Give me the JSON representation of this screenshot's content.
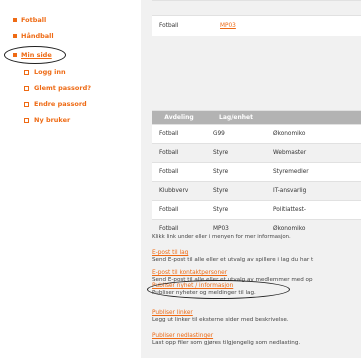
{
  "sidebar": {
    "items": [
      {
        "label": "Fotball"
      },
      {
        "label": "Håndball"
      },
      {
        "label": "Min side"
      }
    ],
    "sub_items": [
      {
        "label": "Logg inn"
      },
      {
        "label": "Glemt passord?"
      },
      {
        "label": "Endre passord"
      },
      {
        "label": "Ny bruker"
      }
    ]
  },
  "top_table": {
    "row1": {
      "avdeling": "",
      "lag": ""
    },
    "row2": {
      "avdeling": "Fotball",
      "lag": "MP03"
    }
  },
  "table": {
    "headers": [
      "Avdeling",
      "Lag/enhet",
      ""
    ],
    "rows": [
      [
        "Fotball",
        "G99",
        "Økonomiko"
      ],
      [
        "Fotball",
        "Styre",
        "Webmaster"
      ],
      [
        "Fotball",
        "Styre",
        "Styremedler"
      ],
      [
        "Klubbverv",
        "Styre",
        "IT-ansvarlig"
      ],
      [
        "Fotball",
        "Styre",
        "Politiattest-"
      ],
      [
        "Fotball",
        "MP03",
        "Økonomiko"
      ]
    ]
  },
  "hint": "Klikk link under eller i menyen for mer informasjon.",
  "links": [
    {
      "title": "E-post til lag",
      "desc": "Send E-post til alle eller et utvalg av spillere i lag du har t"
    },
    {
      "title": "E-post til kontaktpersoner",
      "desc": "Send E-post til alle eller et utvalg av medlemmer med op"
    },
    {
      "title": "Publiser nyhet / informasjon",
      "desc": "Publiser nyheter og meldinger til lag."
    },
    {
      "title": "Publiser linker",
      "desc": "Legg ut linker til eksterne sider med beskrivelse."
    },
    {
      "title": "Publiser nedlastinger",
      "desc": "Last opp filer som gjøres tilgjengelig som nedlasting."
    }
  ]
}
